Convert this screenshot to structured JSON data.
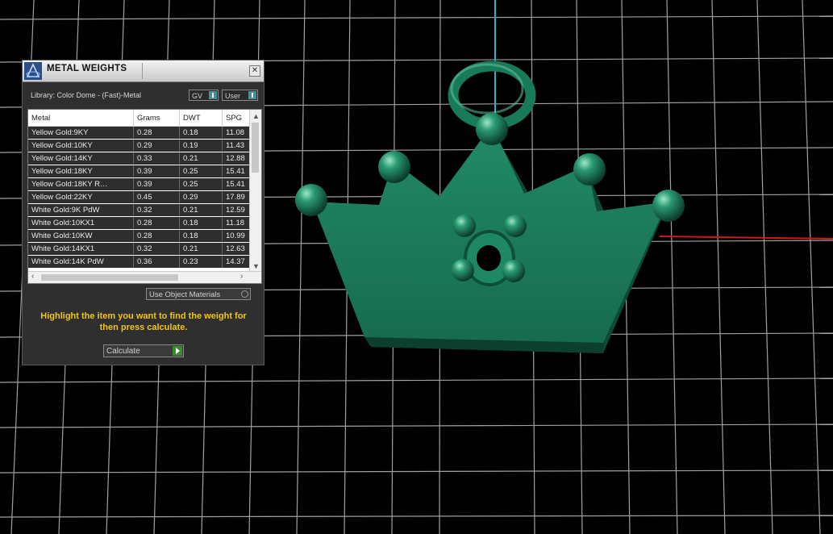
{
  "panel": {
    "title": "METAL WEIGHTS",
    "library_label": "Library: Color Dome - (Fast)-Metal",
    "gv_label": "GV",
    "user_label": "User",
    "use_object_materials_label": "Use Object Materials",
    "instruction": "Highlight the item you want to find the weight for then press calculate.",
    "calculate_label": "Calculate",
    "close_glyph": "✕",
    "logo_icon": "gemvision-logo-icon"
  },
  "table": {
    "headers": [
      "Metal",
      "Grams",
      "DWT",
      "SPG"
    ],
    "rows": [
      [
        "Yellow Gold:9KY",
        "0.28",
        "0.18",
        "11.08"
      ],
      [
        "Yellow Gold:10KY",
        "0.29",
        "0.19",
        "11.43"
      ],
      [
        "Yellow Gold:14KY",
        "0.33",
        "0.21",
        "12.88"
      ],
      [
        "Yellow Gold:18KY",
        "0.39",
        "0.25",
        "15.41"
      ],
      [
        "Yellow Gold:18KY R…",
        "0.39",
        "0.25",
        "15.41"
      ],
      [
        "Yellow Gold:22KY",
        "0.45",
        "0.29",
        "17.89"
      ],
      [
        "White Gold:9K PdW",
        "0.32",
        "0.21",
        "12.59"
      ],
      [
        "White Gold:10KX1",
        "0.28",
        "0.18",
        "11.18"
      ],
      [
        "White Gold:10KW",
        "0.28",
        "0.18",
        "10.99"
      ],
      [
        "White Gold:14KX1",
        "0.32",
        "0.21",
        "12.63"
      ],
      [
        "White Gold:14K PdW",
        "0.36",
        "0.23",
        "14.37"
      ]
    ]
  },
  "colors": {
    "model": "#1d8060",
    "grid": "#ffffff",
    "axis_y": "#2ab3c4",
    "axis_x": "#d01818",
    "instruction_text": "#f0c419"
  }
}
